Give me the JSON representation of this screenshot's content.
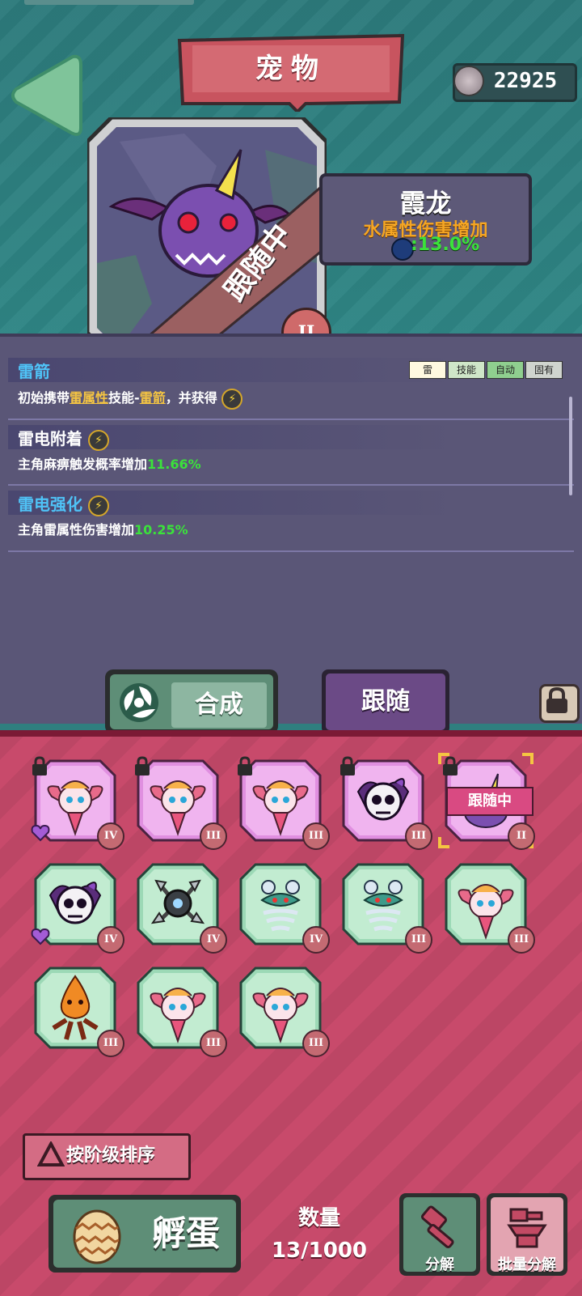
{
  "header": {
    "title": "宠物",
    "coins": "22925"
  },
  "pet": {
    "name": "霞龙",
    "attribute": "水属性伤害增加",
    "attribute_value": ":13.0%",
    "status_ribbon": "跟随中",
    "tier": "II"
  },
  "skills": [
    {
      "title": "雷箭",
      "title_color": "#4fc3f7",
      "desc_parts": [
        "初始携带",
        "雷属性",
        "技能-",
        "雷箭",
        "，并获得"
      ],
      "tags": [
        "雷",
        "技能",
        "自动",
        "固有"
      ]
    },
    {
      "title": "雷电附着",
      "title_color": "#ffffff",
      "desc": "主角麻痹触发概率增加",
      "value": "11.66%"
    },
    {
      "title": "雷电强化",
      "title_color": "#4fc3f7",
      "desc": "主角雷属性伤害增加",
      "value": "10.25%"
    }
  ],
  "tabs": {
    "compose": "合成",
    "follow": "跟随"
  },
  "inventory": {
    "cards": [
      {
        "type": "fairy",
        "tier": "IV",
        "locked": true,
        "color": "pink",
        "badge": "purple-heart"
      },
      {
        "type": "fairy",
        "tier": "III",
        "locked": true,
        "color": "pink"
      },
      {
        "type": "fairy",
        "tier": "III",
        "locked": true,
        "color": "pink"
      },
      {
        "type": "skull",
        "tier": "III",
        "locked": true,
        "color": "pink"
      },
      {
        "type": "dragon",
        "tier": "II",
        "locked": true,
        "color": "pink",
        "following": "跟随中"
      },
      {
        "type": "skull",
        "tier": "IV",
        "locked": false,
        "color": "green",
        "badge": "purple-heart"
      },
      {
        "type": "robot",
        "tier": "IV",
        "locked": false,
        "color": "green"
      },
      {
        "type": "tornado",
        "tier": "IV",
        "locked": false,
        "color": "green"
      },
      {
        "type": "tornado",
        "tier": "III",
        "locked": false,
        "color": "green"
      },
      {
        "type": "fairy",
        "tier": "III",
        "locked": false,
        "color": "green"
      },
      {
        "type": "fire",
        "tier": "III",
        "locked": false,
        "color": "green"
      },
      {
        "type": "fairy",
        "tier": "III",
        "locked": false,
        "color": "green"
      },
      {
        "type": "fairy",
        "tier": "III",
        "locked": false,
        "color": "green"
      }
    ]
  },
  "footer": {
    "sort_label": "按阶级排序",
    "hatch_label": "孵蛋",
    "quantity_label": "数量",
    "quantity_value": "13/1000",
    "decompose_label": "分解",
    "batch_decompose_label": "批量分解"
  }
}
